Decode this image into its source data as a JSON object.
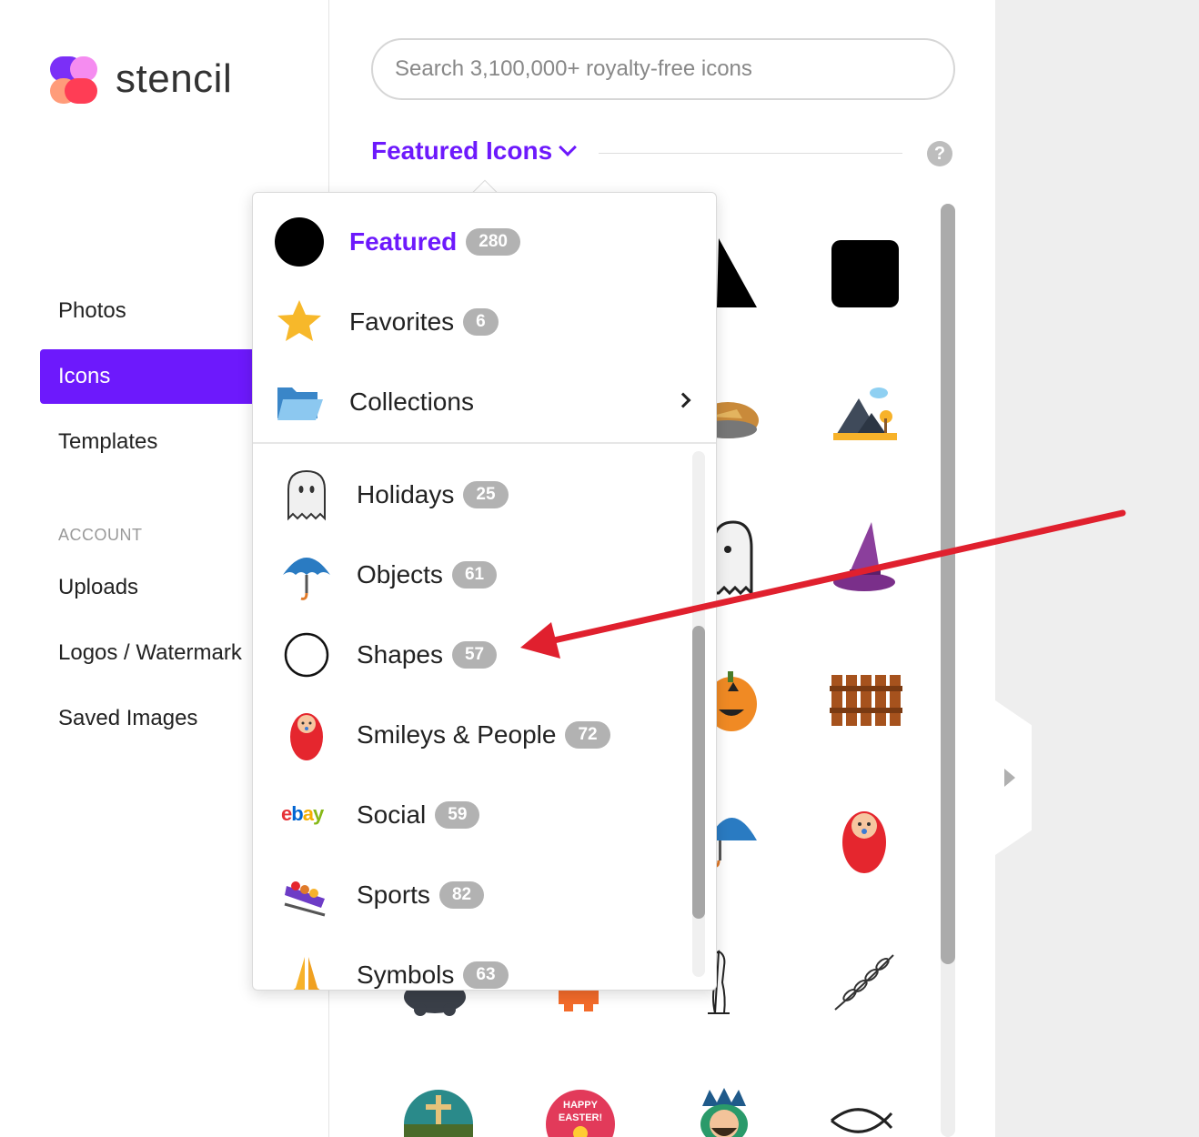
{
  "app": {
    "logo_text": "stencil"
  },
  "sidebar": {
    "items": [
      {
        "label": "Photos"
      },
      {
        "label": "Icons",
        "active": true
      },
      {
        "label": "Templates"
      }
    ],
    "account_heading": "ACCOUNT",
    "account_items": [
      {
        "label": "Uploads"
      },
      {
        "label": "Logos / Watermark"
      },
      {
        "label": "Saved Images"
      }
    ]
  },
  "search": {
    "placeholder": "Search 3,100,000+ royalty-free icons",
    "value": ""
  },
  "featured": {
    "title": "Featured Icons",
    "help": "?"
  },
  "dropdown": {
    "top_items": [
      {
        "label": "Featured",
        "count": "280",
        "icon": "black-circle-icon"
      },
      {
        "label": "Favorites",
        "count": "6",
        "icon": "star-icon"
      },
      {
        "label": "Collections",
        "icon": "folder-icon"
      }
    ],
    "categories": [
      {
        "label": "Holidays",
        "count": "25",
        "icon": "ghost-icon"
      },
      {
        "label": "Objects",
        "count": "61",
        "icon": "umbrella-icon"
      },
      {
        "label": "Shapes",
        "count": "57",
        "icon": "circle-outline-icon"
      },
      {
        "label": "Smileys & People",
        "count": "72",
        "icon": "baby-icon"
      },
      {
        "label": "Social",
        "count": "59",
        "icon": "ebay-icon"
      },
      {
        "label": "Sports",
        "count": "82",
        "icon": "bobsled-icon"
      },
      {
        "label": "Symbols",
        "count": "63",
        "icon": "praying-hands-icon"
      }
    ],
    "ebay_logo": "ebay"
  },
  "grid": {
    "easter_badge": "HAPPY EASTER!"
  },
  "colors": {
    "accent": "#6d19fc",
    "badge": "#b2b2b2",
    "annotation_arrow": "#e0202e"
  }
}
